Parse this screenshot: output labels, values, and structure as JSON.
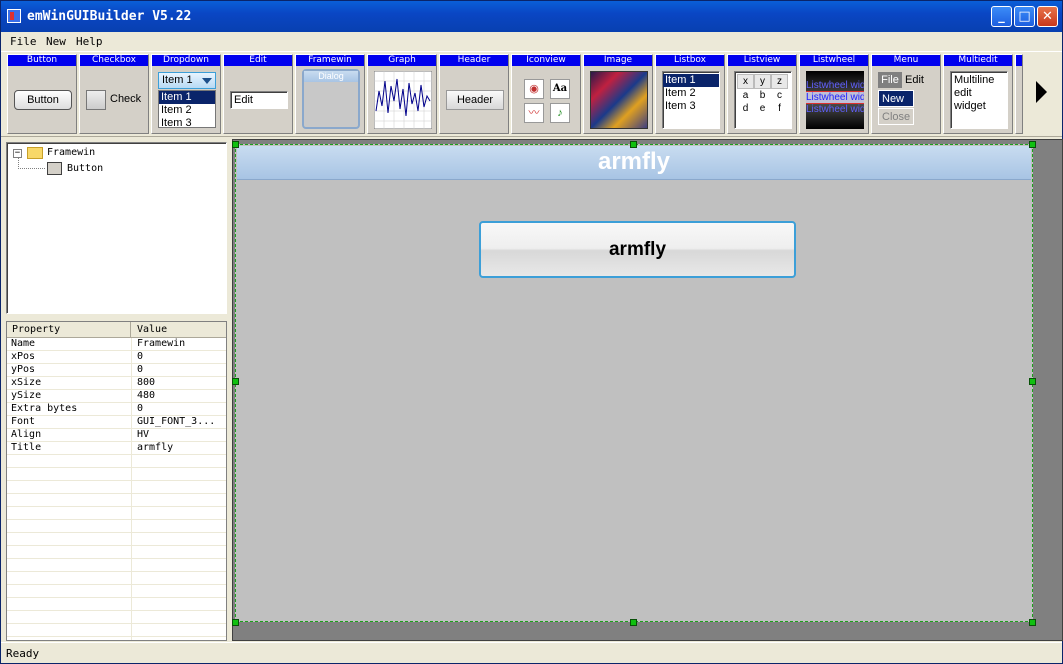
{
  "window": {
    "title": "emWinGUIBuilder V5.22",
    "min_label": "_",
    "max_label": "□",
    "close_label": "✕"
  },
  "menu": [
    "File",
    "New",
    "Help"
  ],
  "toolbar": {
    "widgets": [
      "Button",
      "Checkbox",
      "Dropdown",
      "Edit",
      "Framewin",
      "Graph",
      "Header",
      "Iconview",
      "Image",
      "Listbox",
      "Listview",
      "Listwheel",
      "Menu",
      "Multiedit"
    ],
    "button_preview": "Button",
    "checkbox_preview": "Check",
    "dropdown_selected": "Item 1",
    "dropdown_items": [
      "Item 1",
      "Item 2",
      "Item 3"
    ],
    "edit_preview": "Edit",
    "framewin_preview": "Dialog",
    "header_preview": "Header",
    "iconview_aa": "Aa",
    "listbox_items": [
      "Item 1",
      "Item 2",
      "Item 3"
    ],
    "listview_cells": [
      "x",
      "y",
      "z",
      "a",
      "b",
      "c",
      "d",
      "e",
      "f"
    ],
    "listwheel_items": [
      "Listwheel wid",
      "Listwheel wid",
      "Listwheel wid"
    ],
    "menu_file": "File",
    "menu_edit": "Edit",
    "menu_new": "New",
    "menu_close": "Close",
    "multiedit_lines": [
      "Multiline",
      "edit",
      "widget"
    ]
  },
  "tree": {
    "root": "Framewin",
    "child": "Button"
  },
  "properties": {
    "header_property": "Property",
    "header_value": "Value",
    "rows": [
      {
        "name": "Name",
        "value": "Framewin"
      },
      {
        "name": "xPos",
        "value": "0"
      },
      {
        "name": "yPos",
        "value": "0"
      },
      {
        "name": "xSize",
        "value": "800"
      },
      {
        "name": "ySize",
        "value": "480"
      },
      {
        "name": "Extra bytes",
        "value": "0"
      },
      {
        "name": "Font",
        "value": "GUI_FONT_3..."
      },
      {
        "name": "Align",
        "value": "HV"
      },
      {
        "name": "Title",
        "value": "armfly"
      }
    ]
  },
  "design": {
    "frame_title": "armfly",
    "button_label": "armfly"
  },
  "status": "Ready",
  "colors": {
    "title_blue": "#0a46c4",
    "widget_header_blue": "#0000ee",
    "selection_green": "#10c010",
    "button_border": "#3c9fd8"
  }
}
